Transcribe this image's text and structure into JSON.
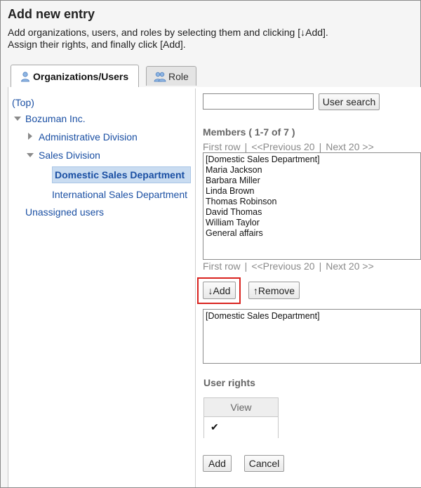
{
  "header": {
    "title": "Add new entry",
    "desc_line1": "Add organizations, users, and roles by selecting them and clicking [↓Add].",
    "desc_line2": "Assign their rights, and finally click [Add]."
  },
  "tabs": [
    {
      "label": "Organizations/Users",
      "icon": "user-icon",
      "active": true
    },
    {
      "label": "Role",
      "icon": "group-icon",
      "active": false
    }
  ],
  "tree": {
    "top": "(Top)",
    "root": "Bozuman Inc.",
    "admin": "Administrative Division",
    "sales": "Sales Division",
    "domestic": "Domestic Sales Department",
    "international": "International Sales Department",
    "unassigned": "Unassigned users"
  },
  "search": {
    "value": "",
    "button": "User search"
  },
  "members": {
    "heading": "Members ( 1-7 of 7 )",
    "first_row": "First row",
    "prev": "<<Previous 20",
    "next": "Next 20 >>",
    "items": [
      "[Domestic Sales Department]",
      "Maria Jackson",
      "Barbara Miller",
      "Linda Brown",
      "Thomas Robinson",
      "David Thomas",
      "William Taylor",
      "General affairs"
    ]
  },
  "actions": {
    "add": "↓Add",
    "remove": "↑Remove"
  },
  "selected": {
    "items": [
      "[Domestic Sales Department]"
    ]
  },
  "rights": {
    "heading": "User rights",
    "column": "View",
    "checked": true,
    "check_glyph": "✔"
  },
  "footer": {
    "add": "Add",
    "cancel": "Cancel"
  },
  "colors": {
    "link": "#1a4fa3",
    "highlight": "#d9231f",
    "selected_bg": "#c9dcf1"
  }
}
